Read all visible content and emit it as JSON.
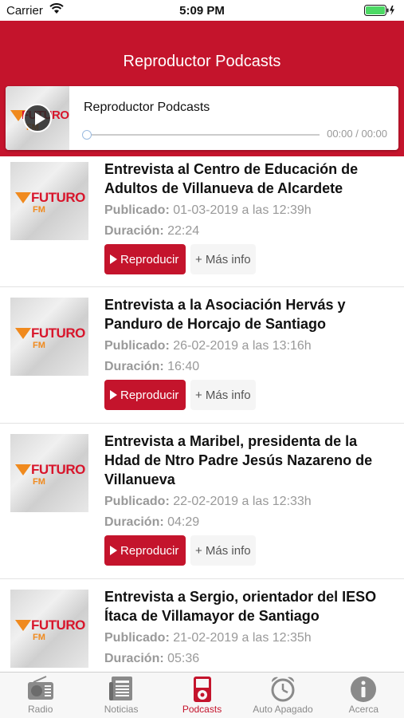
{
  "status_bar": {
    "carrier": "Carrier",
    "time": "5:09 PM"
  },
  "header": {
    "title": "Reproductor Podcasts"
  },
  "player": {
    "title": "Reproductor Podcasts",
    "time": "00:00 / 00:00",
    "progress": 0
  },
  "logo": {
    "brand": "FUTURO",
    "sub": "FM"
  },
  "labels": {
    "published": "Publicado:",
    "duration": "Duración:",
    "play_button": "Reproducir",
    "more_button": "+ Más info"
  },
  "podcasts": [
    {
      "title": "Entrevista al Centro de Educación de Adultos de Villanueva de Alcardete",
      "published": "01-03-2019 a las 12:39h",
      "duration": "22:24"
    },
    {
      "title": "Entrevista a la Asociación Hervás y Panduro de Horcajo de Santiago",
      "published": "26-02-2019 a las 13:16h",
      "duration": "16:40"
    },
    {
      "title": "Entrevista a Maribel, presidenta de la Hdad de Ntro Padre Jesús Nazareno de Villanueva",
      "published": "22-02-2019 a las 12:33h",
      "duration": "04:29"
    },
    {
      "title": "Entrevista a Sergio, orientador del IESO Ítaca de Villamayor de Santiago",
      "published": "21-02-2019 a las 12:35h",
      "duration": "05:36"
    }
  ],
  "tabs": [
    {
      "label": "Radio",
      "icon": "radio-icon",
      "active": false
    },
    {
      "label": "Noticias",
      "icon": "newspaper-icon",
      "active": false
    },
    {
      "label": "Podcasts",
      "icon": "ipod-icon",
      "active": true
    },
    {
      "label": "Auto Apagado",
      "icon": "alarm-clock-icon",
      "active": false
    },
    {
      "label": "Acerca",
      "icon": "info-icon",
      "active": false
    }
  ],
  "colors": {
    "brand": "#c4142c",
    "tab_inactive": "#8a8a8a"
  }
}
